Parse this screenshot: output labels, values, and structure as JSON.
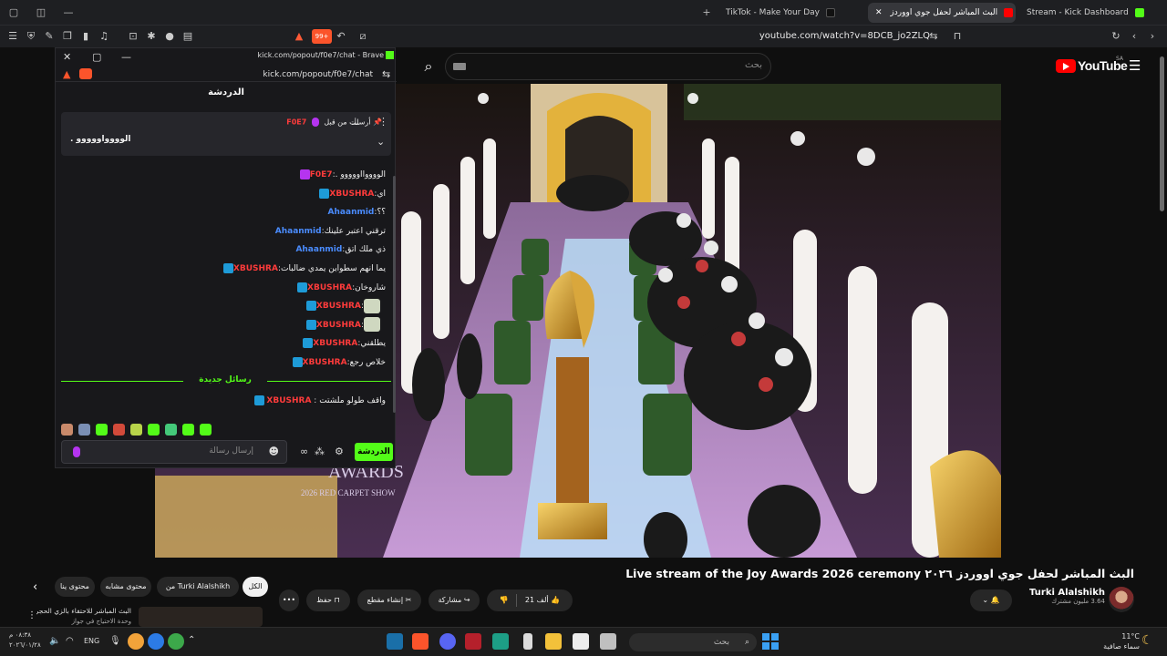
{
  "browser": {
    "tabs": [
      {
        "label": "TikTok - Make Your Day",
        "active": false
      },
      {
        "label": "البث المباشر لحفل جوي اووردز",
        "active": true
      },
      {
        "label": "Stream - Kick Dashboard",
        "active": false
      }
    ],
    "url": "youtube.com/watch?v=8DCB_jo2ZLQ",
    "badge_count": "99+"
  },
  "youtube": {
    "search_placeholder": "بحث",
    "logo_text": "YouTube",
    "country": "SA",
    "video_title": "البث المباشر لحفل جوي اووردز ٢٠٢٦ Live stream of the Joy Awards 2026 ceremony",
    "channel_name": "Turki Alalshikh",
    "subscribers": "3.64 مليون مشترك",
    "likes": "21 ألف",
    "share_label": "مشاركة",
    "clip_label": "إنشاء مقطع",
    "save_label": "حفظ",
    "more_label": "•••",
    "chips": [
      "الكل",
      "من Turki Alalshikh",
      "محتوى مشابه",
      "محتوى ينا"
    ],
    "overlay_text": [
      "AWARDS",
      "2026 RED CARPET SHOW"
    ],
    "next_video_title": "البث المباشر للاحتفاء بالزي الحجرم",
    "next_video_sub": "وحدة الاحتياج في جواز"
  },
  "kick_chat": {
    "window_title": "kick.com/popout/f0e7/chat - Brave",
    "url": "kick.com/popout/f0e7/chat",
    "panel_title": "الدردشة",
    "pinned_by": "أرسلت من قبل",
    "pinned_user": "F0E7",
    "pinned_text": "الوووواووووو .",
    "messages": [
      {
        "user": "F0E7",
        "text": "الووووااووووو .",
        "color": "#ff3b3b"
      },
      {
        "user": "XBUSHRA",
        "text": "اي",
        "color": "#ff3b3b"
      },
      {
        "user": "Ahaanmid",
        "text": "؟؟",
        "color": "#4a8cff"
      },
      {
        "user": "Ahaanmid",
        "text": "ترقني اعتبر علينك",
        "color": "#4a8cff"
      },
      {
        "user": "Ahaanmid",
        "text": "ذي ملك اتق",
        "color": "#4a8cff"
      },
      {
        "user": "XBUSHRA",
        "text": "يما انهم سطواين يمدي ضالبات",
        "color": "#ff3b3b"
      },
      {
        "user": "XBUSHRA",
        "text": "شاروخان",
        "color": "#ff3b3b"
      },
      {
        "user": "XBUSHRA",
        "text": "",
        "color": "#ff3b3b"
      },
      {
        "user": "XBUSHRA",
        "text": "",
        "color": "#ff3b3b"
      },
      {
        "user": "XBUSHRA",
        "text": "يطلقني",
        "color": "#ff3b3b"
      },
      {
        "user": "XBUSHRA",
        "text": "خلاص رجع",
        "color": "#ff3b3b"
      }
    ],
    "new_messages_label": "رسائل جديدة",
    "last_message": {
      "user": "XBUSHRA",
      "text": "واقف طولو ملشتت"
    },
    "input_placeholder": "إرسال رسالة",
    "send_label": "الدردشة"
  },
  "taskbar": {
    "search_placeholder": "بحث",
    "language": "ENG",
    "time": "٠٨:٣٨ م",
    "date": "٢٠٢٦/٠١/٢٨",
    "temperature": "11°C",
    "weather": "سماء صافية"
  }
}
